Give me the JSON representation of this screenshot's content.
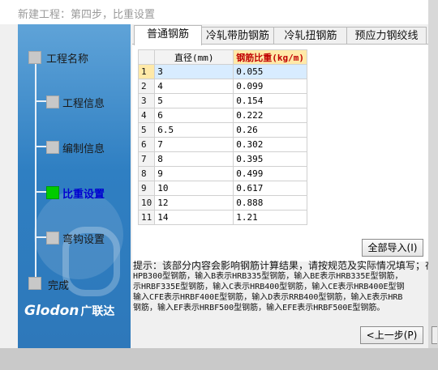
{
  "window": {
    "title": "新建工程：第四步，比重设置"
  },
  "sidebar": {
    "steps": [
      {
        "label": "工程名称",
        "active": false
      },
      {
        "label": "工程信息",
        "active": false
      },
      {
        "label": "编制信息",
        "active": false
      },
      {
        "label": "比重设置",
        "active": true
      },
      {
        "label": "弯钩设置",
        "active": false
      },
      {
        "label": "完成",
        "active": false
      }
    ],
    "logo_text": "Glodon",
    "logo_cn": "广联达"
  },
  "tabs": [
    "普通钢筋",
    "冷轧带肋钢筋",
    "冷轧扭钢筋",
    "预应力钢绞线"
  ],
  "active_tab": 0,
  "table": {
    "headers": [
      "直径(mm)",
      "钢筋比重(kg/m)"
    ],
    "rows": [
      [
        "1",
        "3",
        "0.055"
      ],
      [
        "2",
        "4",
        "0.099"
      ],
      [
        "3",
        "5",
        "0.154"
      ],
      [
        "4",
        "6",
        "0.222"
      ],
      [
        "5",
        "6.5",
        "0.26"
      ],
      [
        "6",
        "7",
        "0.302"
      ],
      [
        "7",
        "8",
        "0.395"
      ],
      [
        "8",
        "9",
        "0.499"
      ],
      [
        "9",
        "10",
        "0.617"
      ],
      [
        "10",
        "12",
        "0.888"
      ],
      [
        "11",
        "14",
        "1.21"
      ]
    ]
  },
  "import_button": "全部导入(I)",
  "hint": {
    "line1": "提示：该部分内容会影响钢筋计算结果，请按规范及实际情况填写；在",
    "line2": "HPB300型钢筋，输入B表示HRB335型钢筋，输入BE表示HRB335E型钢筋，",
    "line3": "示HRBF335E型钢筋，输入C表示HRB400型钢筋，输入CE表示HRB400E型钢",
    "line4": "输入CFE表示HRBF400E型钢筋，输入D表示RRB400型钢筋，输入E表示HRB",
    "line5": "钢筋，输入EF表示HRBF500型钢筋，输入EFE表示HRBF500E型钢筋。"
  },
  "back_button": "<上一步(P)"
}
